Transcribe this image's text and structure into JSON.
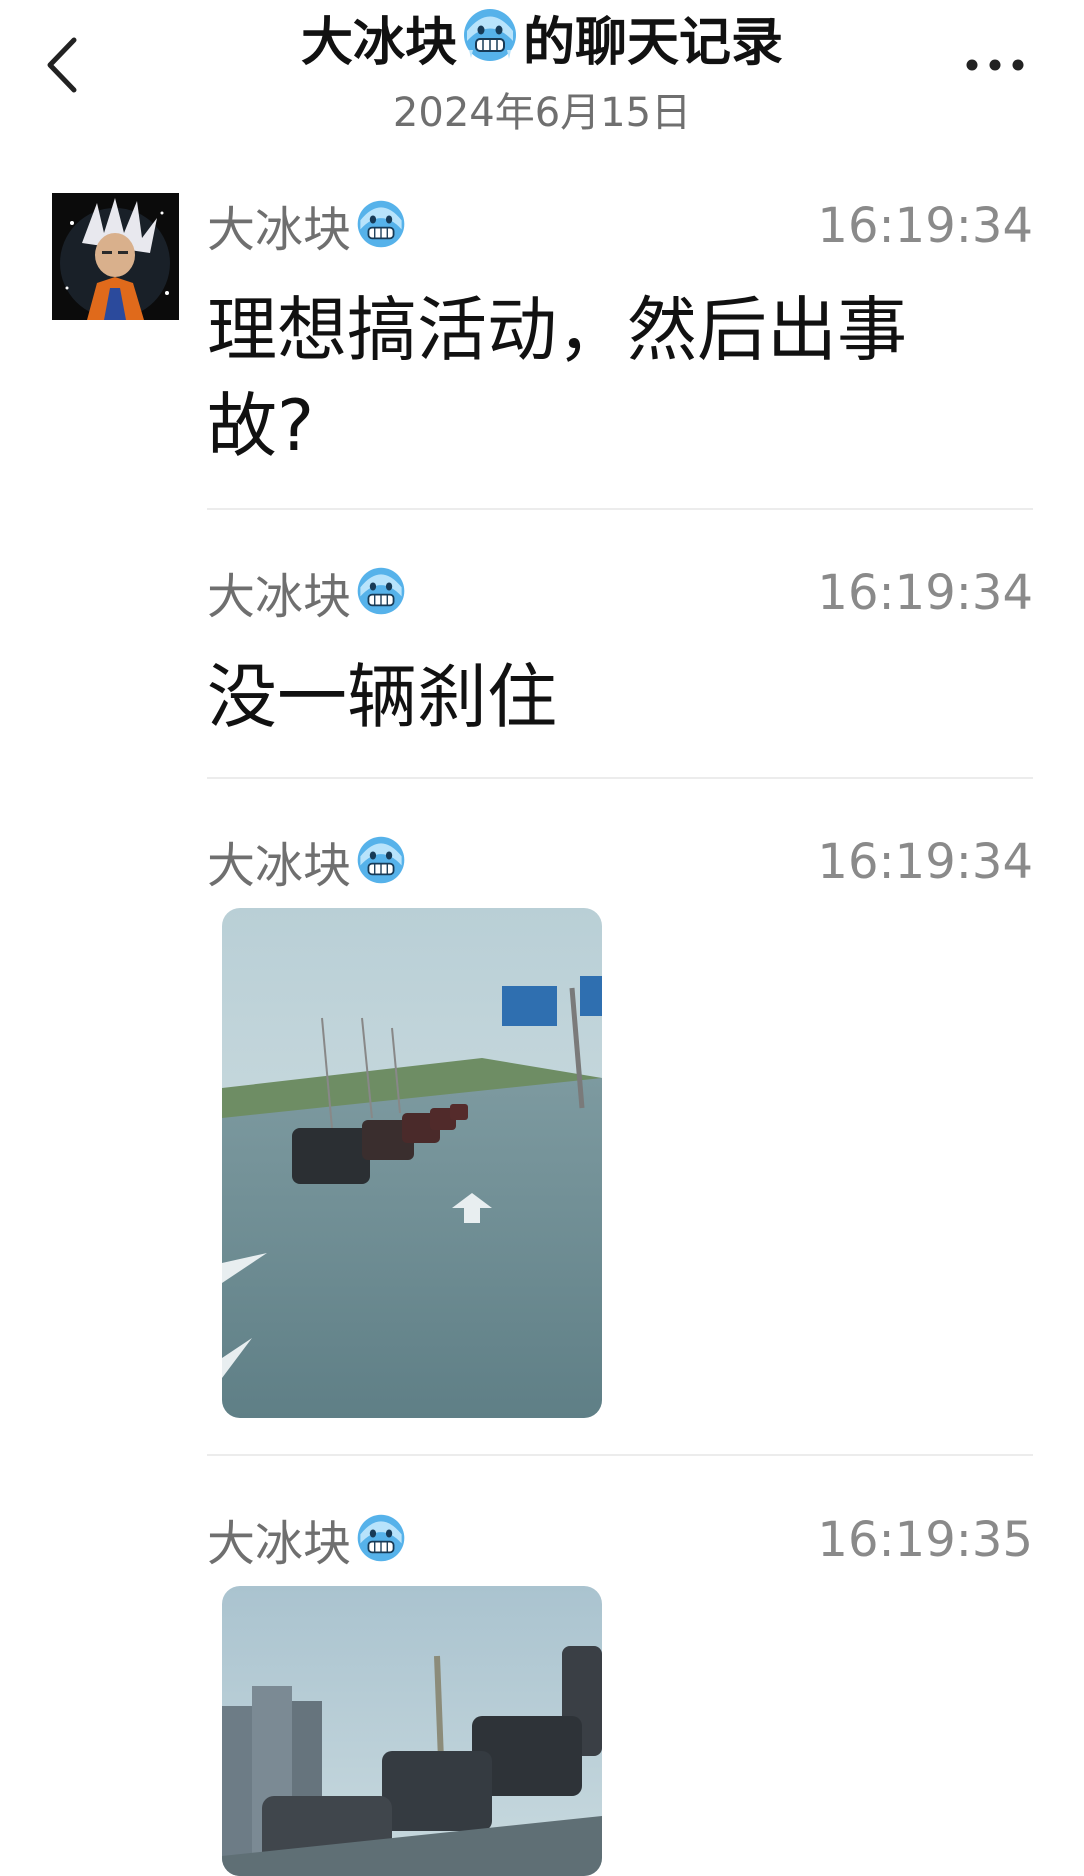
{
  "header": {
    "name": "大冰块",
    "suffix": "的聊天记录",
    "date": "2024年6月15日"
  },
  "messages": [
    {
      "sender": "大冰块",
      "time": "16:19:34",
      "text": "理想搞活动，然后出事故?"
    },
    {
      "sender": "大冰块",
      "time": "16:19:34",
      "text": "没一辆刹住"
    },
    {
      "sender": "大冰块",
      "time": "16:19:34",
      "type": "image",
      "alt": "rainy road traffic photo"
    },
    {
      "sender": "大冰块",
      "time": "16:19:35",
      "type": "image",
      "alt": "rainy road traffic photo"
    }
  ],
  "icons": {
    "back": "chevron-left-icon",
    "more": "more-dots-icon",
    "emoji": "freezing-face-emoji"
  },
  "colors": {
    "secondary_text": "#6f6f6f",
    "divider": "#ececec",
    "emoji_blue": "#4aa3e0"
  }
}
